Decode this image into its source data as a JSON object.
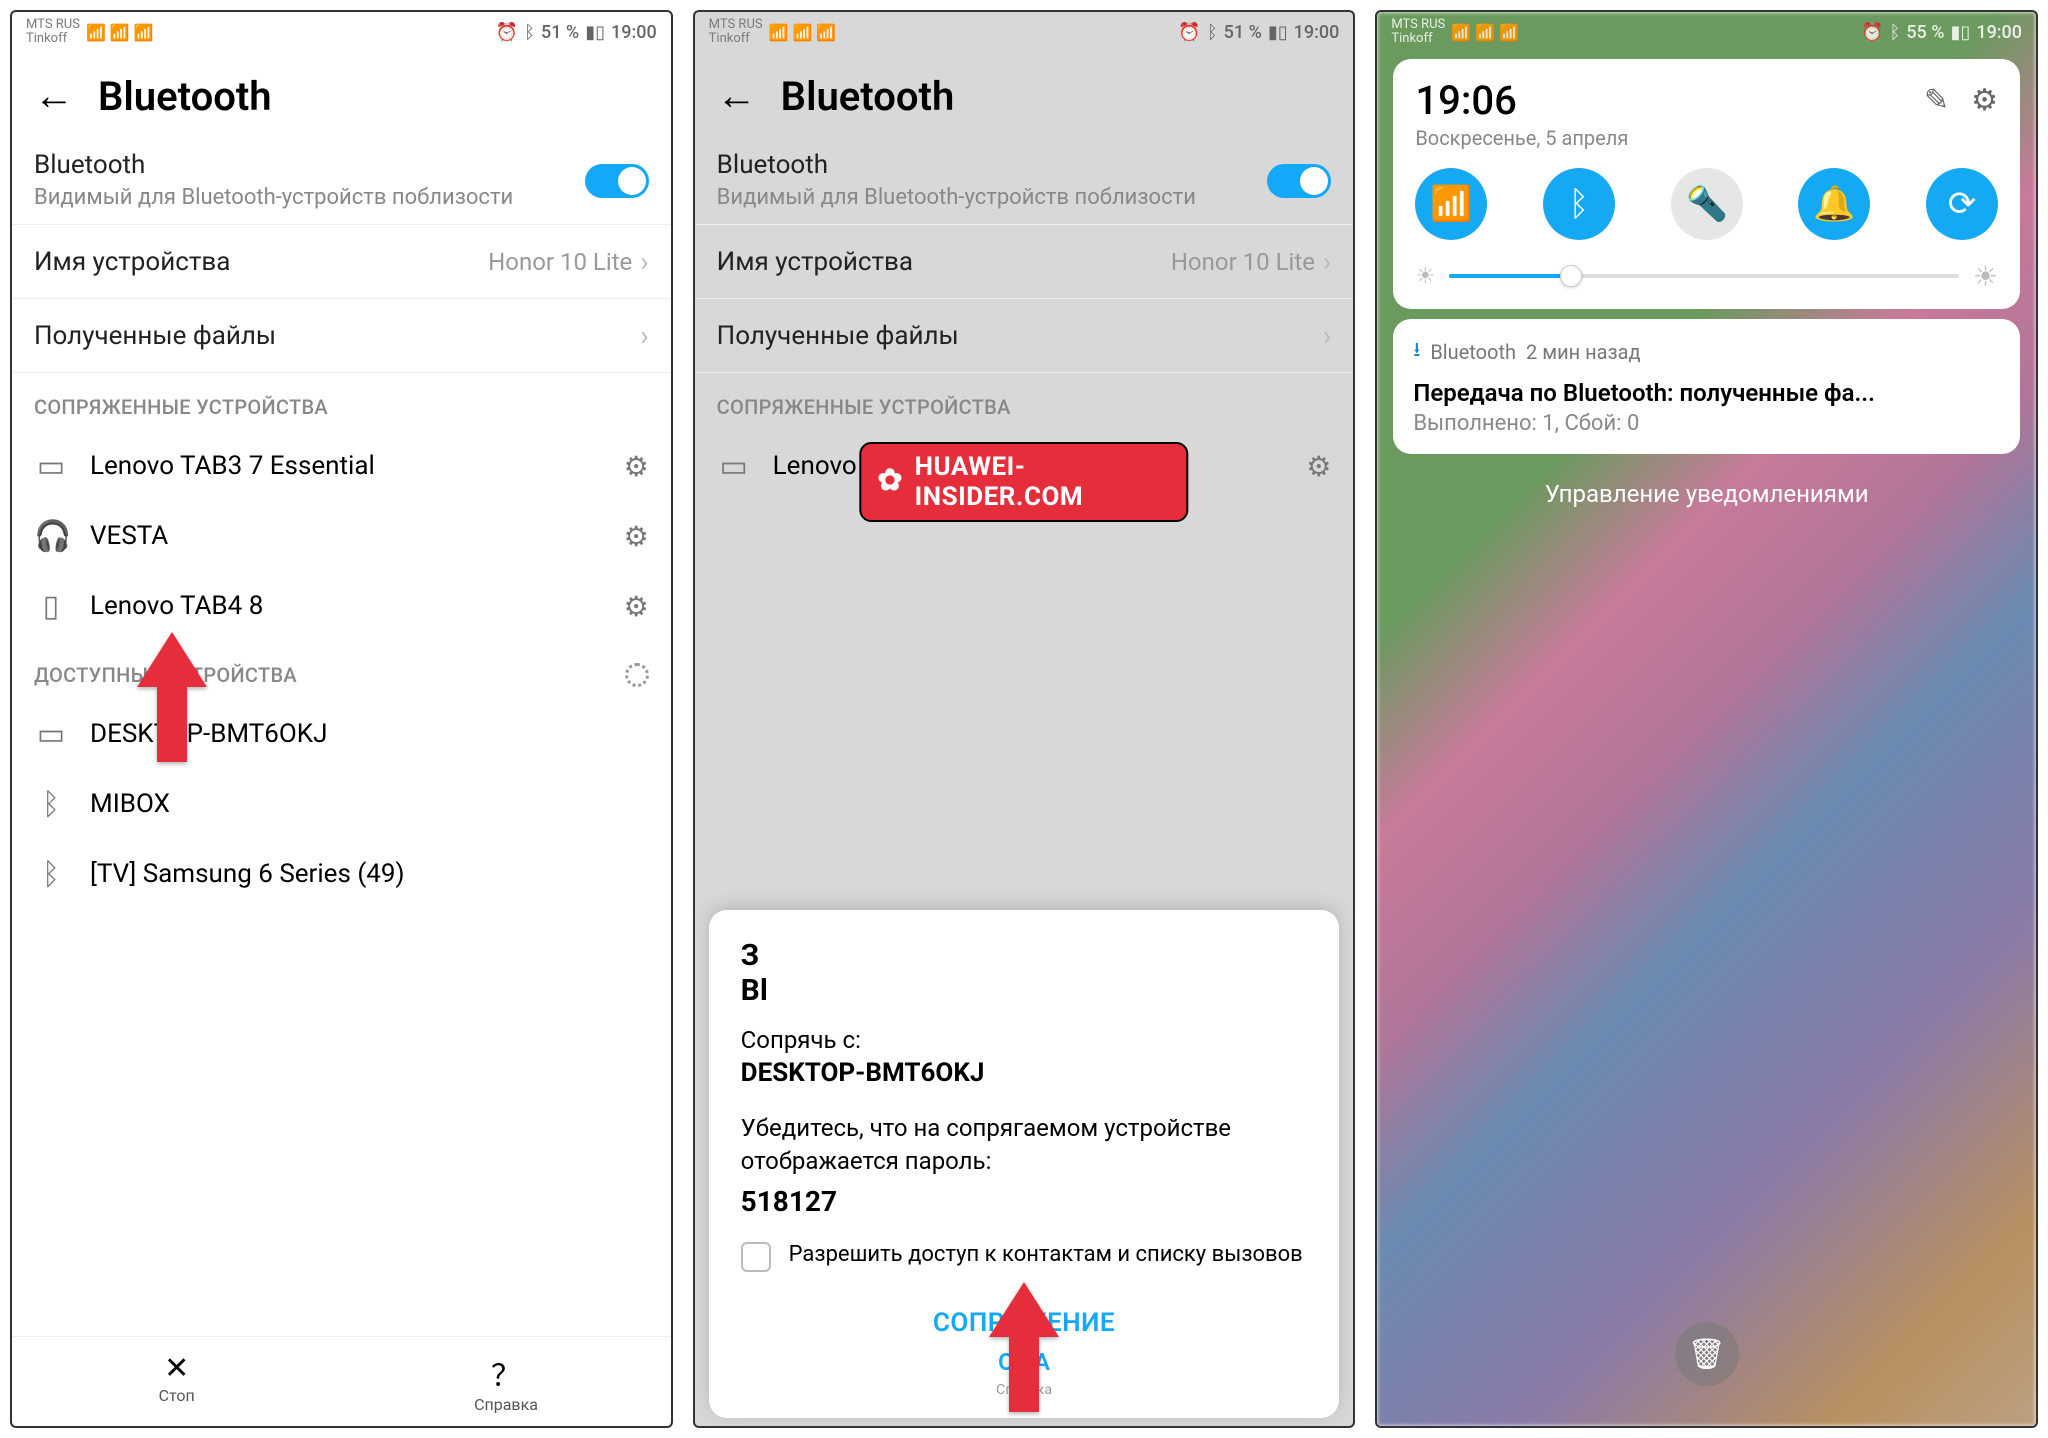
{
  "status": {
    "carrier_line1": "MTS RUS",
    "carrier_line2": "Tinkoff",
    "battery_12": "51 %",
    "time_12": "19:00",
    "battery_3": "55 %",
    "time_3": "19:00"
  },
  "screen1": {
    "title": "Bluetooth",
    "toggle_label": "Bluetooth",
    "toggle_sublabel": "Видимый для Bluetooth-устройств поблизости",
    "device_name_label": "Имя устройства",
    "device_name_value": "Honor 10 Lite",
    "received_files_label": "Полученные файлы",
    "section_paired": "СОПРЯЖЕННЫЕ УСТРОЙСТВА",
    "paired": [
      {
        "icon": "laptop",
        "name": "Lenovo TAB3 7 Essential"
      },
      {
        "icon": "headphones",
        "name": "VESTA"
      },
      {
        "icon": "phone",
        "name": "Lenovo TAB4 8"
      }
    ],
    "section_available": "ДОСТУПНЫЕ УСТРОЙСТВА",
    "available": [
      {
        "icon": "laptop",
        "name": "DESKTOP-BMT6OKJ"
      },
      {
        "icon": "bluetooth",
        "name": "MIBOX"
      },
      {
        "icon": "bluetooth",
        "name": "[TV] Samsung 6 Series (49)"
      }
    ],
    "bottom_stop": "Стоп",
    "bottom_help": "Справка"
  },
  "screen2": {
    "dialog_title_behind": "З\nBl",
    "pair_prefix": "Сопрячь с:",
    "pair_device": "DESKTOP-BMT6OKJ",
    "pair_msg": "Убедитесь, что на сопрягаемом устройстве отображается пароль:",
    "pair_code": "518127",
    "checkbox_label": "Разрешить доступ к контактам и списку вызовов",
    "action_pair": "СОПРЯЖЕНИЕ",
    "action_cancel": "ОТ         А",
    "bottom_help": "Справка"
  },
  "watermark": "HUAWEI-INSIDER.COM",
  "screen3": {
    "time": "19:06",
    "date": "Воскресенье, 5 апреля",
    "toggles": [
      "wifi",
      "bluetooth",
      "flashlight",
      "bell",
      "rotate"
    ],
    "notif_app": "Bluetooth",
    "notif_time": "2 мин назад",
    "notif_title": "Передача по Bluetooth: полученные фа...",
    "notif_body": "Выполнено: 1, Сбой: 0",
    "manage": "Управление уведомлениями"
  }
}
